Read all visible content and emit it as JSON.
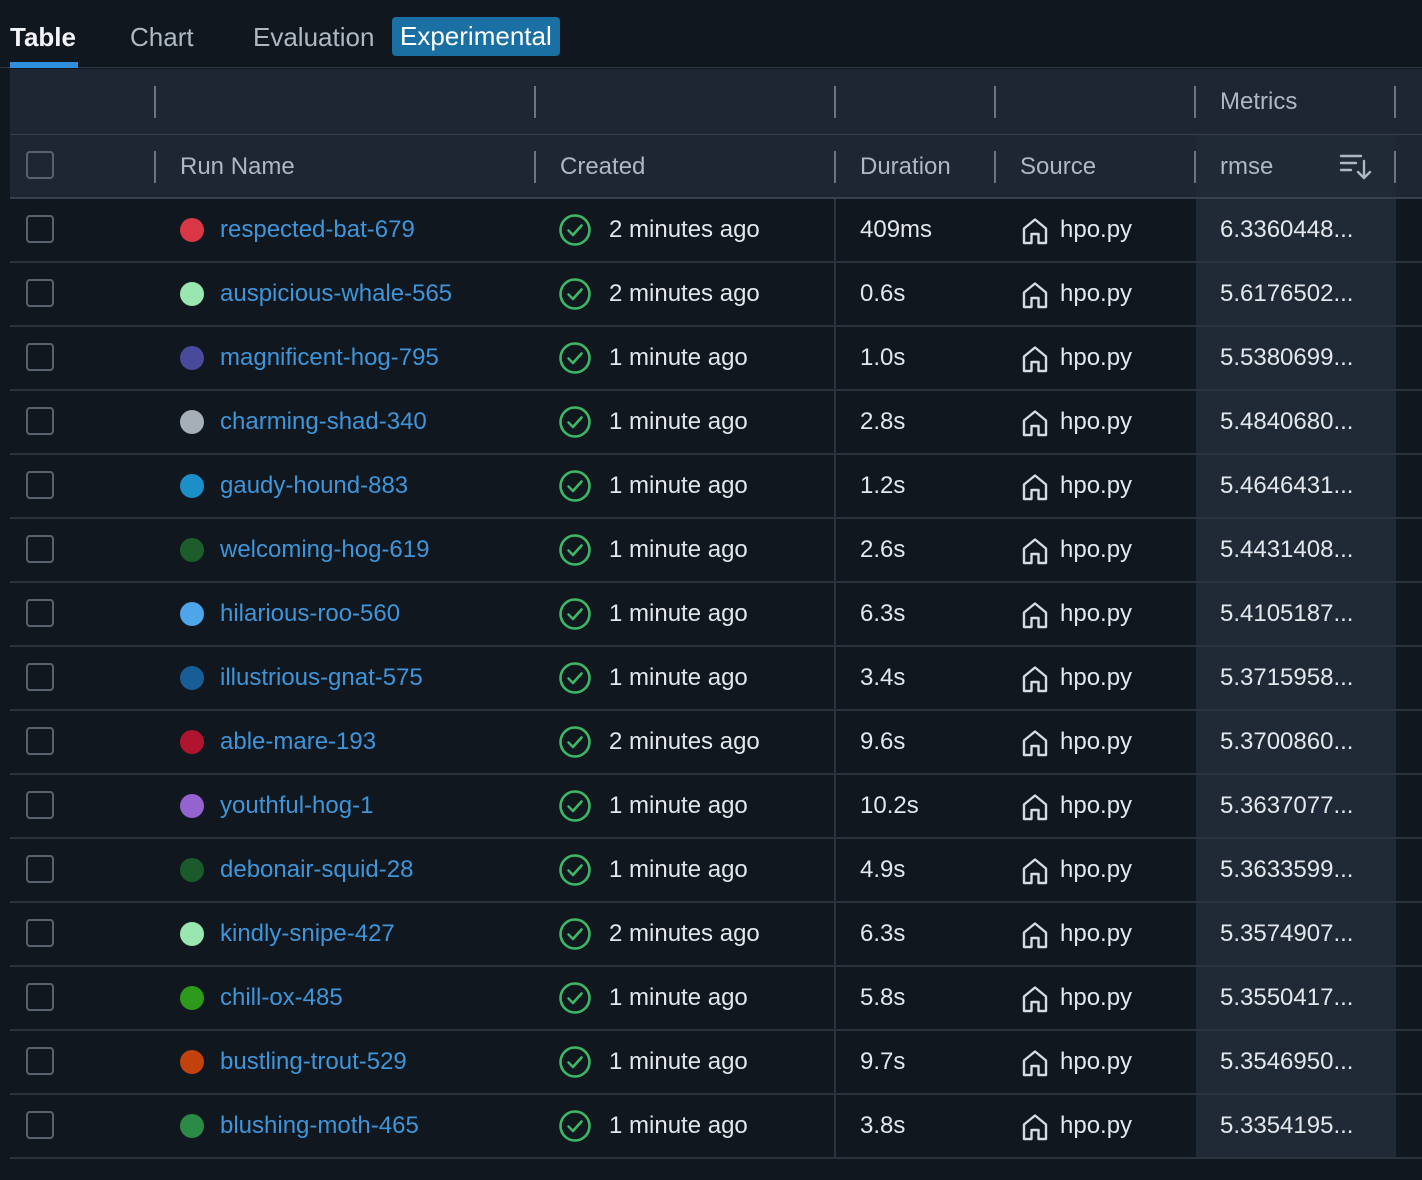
{
  "tabs": [
    {
      "label": "Table"
    },
    {
      "label": "Chart"
    },
    {
      "label": "Evaluation"
    }
  ],
  "experimental_tag": "Experimental",
  "group_header": {
    "metrics": "Metrics"
  },
  "columns": {
    "run_name": "Run Name",
    "created": "Created",
    "duration": "Duration",
    "source": "Source",
    "metric": "rmse"
  },
  "icons": {
    "status": "check-circle-icon",
    "source": "home-icon",
    "sort": "sort-descending-icon"
  },
  "colors": {
    "accent": "#2f8fdc",
    "link": "#3f95d9",
    "success": "#3fb865",
    "tag_bg": "#1a6fa3"
  },
  "rows": [
    {
      "name": "respected-bat-679",
      "color": "#d93646",
      "created": "2 minutes ago",
      "duration": "409ms",
      "source": "hpo.py",
      "rmse": "6.3360448..."
    },
    {
      "name": "auspicious-whale-565",
      "color": "#9ae6b0",
      "created": "2 minutes ago",
      "duration": "0.6s",
      "source": "hpo.py",
      "rmse": "5.6176502..."
    },
    {
      "name": "magnificent-hog-795",
      "color": "#4a4a9c",
      "created": "1 minute ago",
      "duration": "1.0s",
      "source": "hpo.py",
      "rmse": "5.5380699..."
    },
    {
      "name": "charming-shad-340",
      "color": "#a6aeb8",
      "created": "1 minute ago",
      "duration": "2.8s",
      "source": "hpo.py",
      "rmse": "5.4840680..."
    },
    {
      "name": "gaudy-hound-883",
      "color": "#1c8fc8",
      "created": "1 minute ago",
      "duration": "1.2s",
      "source": "hpo.py",
      "rmse": "5.4646431..."
    },
    {
      "name": "welcoming-hog-619",
      "color": "#1d5c2b",
      "created": "1 minute ago",
      "duration": "2.6s",
      "source": "hpo.py",
      "rmse": "5.4431408..."
    },
    {
      "name": "hilarious-roo-560",
      "color": "#4ea5ea",
      "created": "1 minute ago",
      "duration": "6.3s",
      "source": "hpo.py",
      "rmse": "5.4105187..."
    },
    {
      "name": "illustrious-gnat-575",
      "color": "#175d96",
      "created": "1 minute ago",
      "duration": "3.4s",
      "source": "hpo.py",
      "rmse": "5.3715958..."
    },
    {
      "name": "able-mare-193",
      "color": "#b0142e",
      "created": "2 minutes ago",
      "duration": "9.6s",
      "source": "hpo.py",
      "rmse": "5.3700860..."
    },
    {
      "name": "youthful-hog-1",
      "color": "#9563d0",
      "created": "1 minute ago",
      "duration": "10.2s",
      "source": "hpo.py",
      "rmse": "5.3637077..."
    },
    {
      "name": "debonair-squid-28",
      "color": "#1b5a2a",
      "created": "1 minute ago",
      "duration": "4.9s",
      "source": "hpo.py",
      "rmse": "5.3633599..."
    },
    {
      "name": "kindly-snipe-427",
      "color": "#9ae6b0",
      "created": "2 minutes ago",
      "duration": "6.3s",
      "source": "hpo.py",
      "rmse": "5.3574907..."
    },
    {
      "name": "chill-ox-485",
      "color": "#2e9a1c",
      "created": "1 minute ago",
      "duration": "5.8s",
      "source": "hpo.py",
      "rmse": "5.3550417..."
    },
    {
      "name": "bustling-trout-529",
      "color": "#c2420e",
      "created": "1 minute ago",
      "duration": "9.7s",
      "source": "hpo.py",
      "rmse": "5.3546950..."
    },
    {
      "name": "blushing-moth-465",
      "color": "#2c8a47",
      "created": "1 minute ago",
      "duration": "3.8s",
      "source": "hpo.py",
      "rmse": "5.3354195..."
    }
  ]
}
